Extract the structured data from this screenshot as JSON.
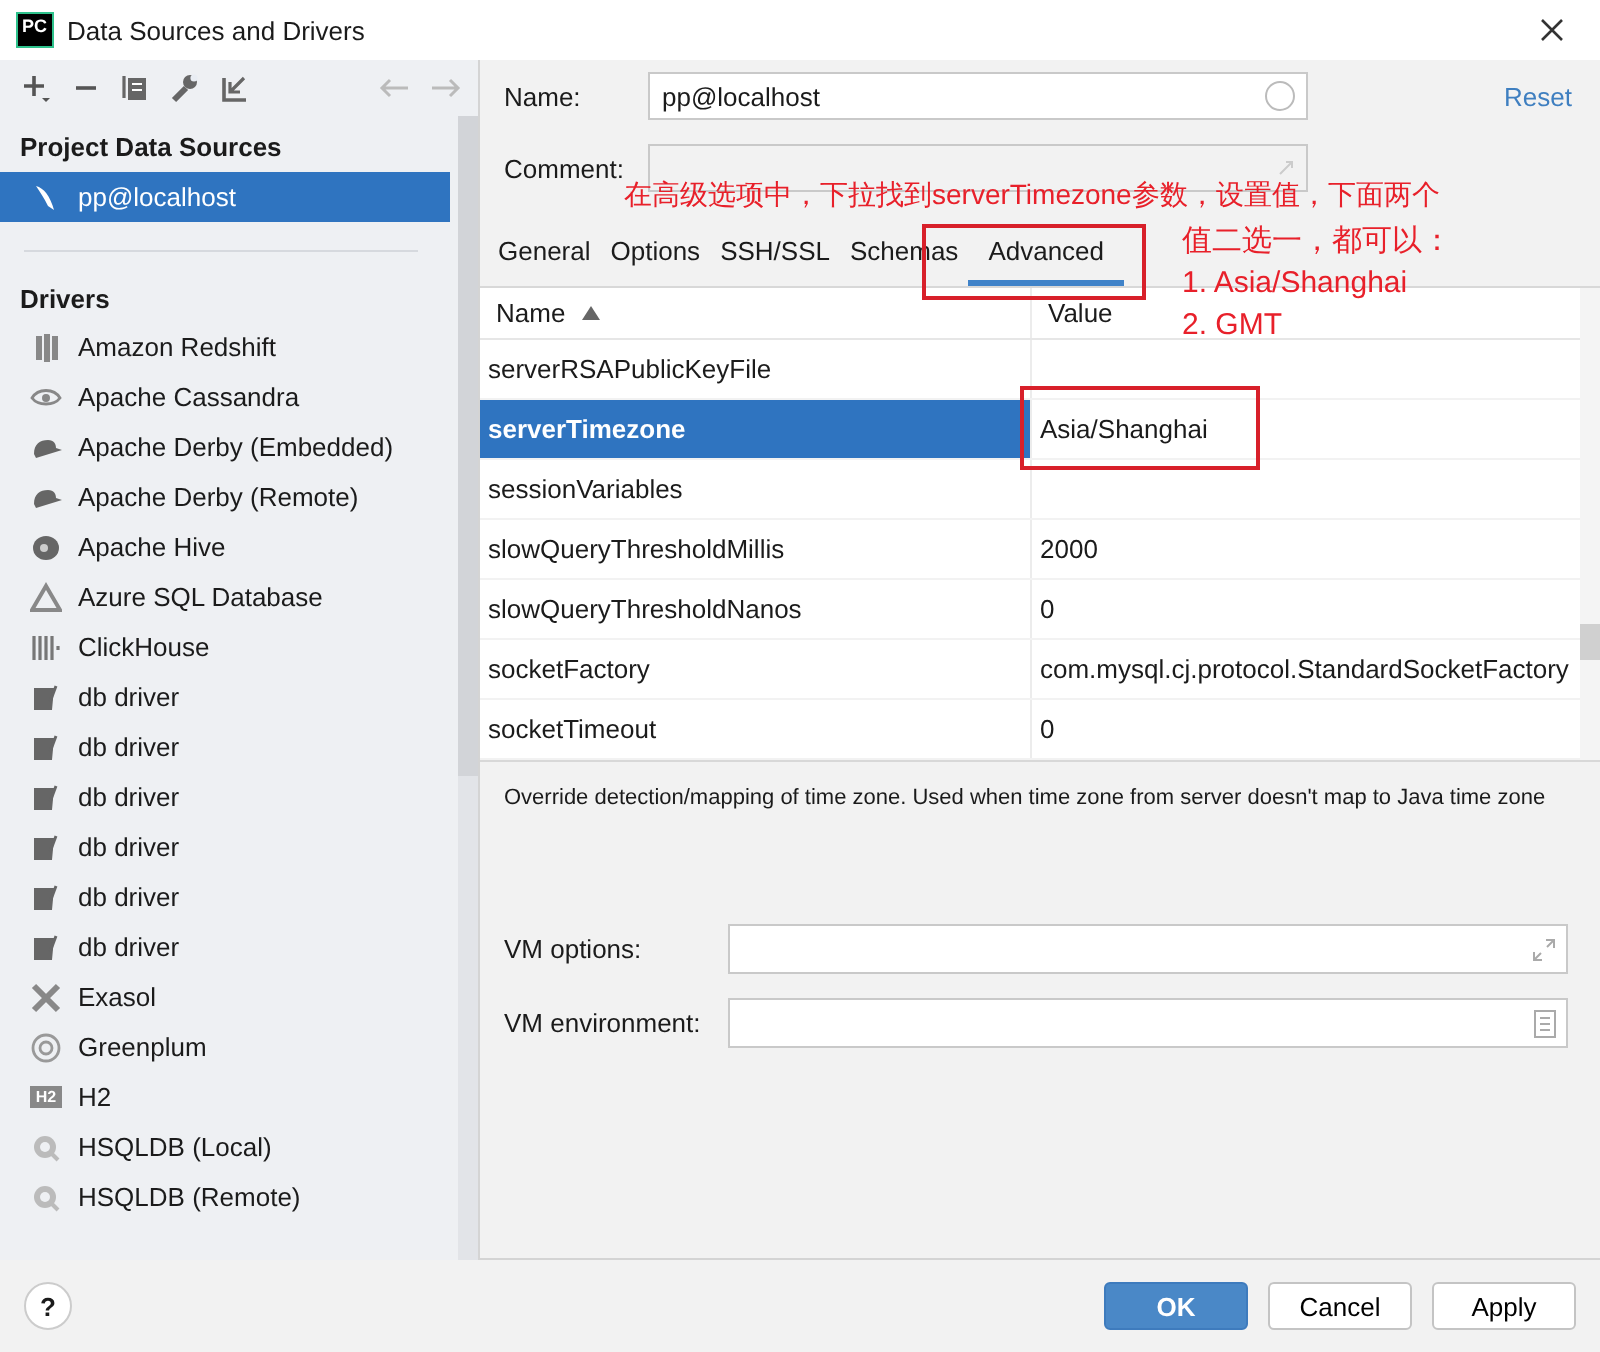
{
  "window": {
    "app_badge": "PC",
    "title": "Data Sources and Drivers"
  },
  "sidebar": {
    "project_heading": "Project Data Sources",
    "project_items": [
      {
        "label": "pp@localhost",
        "selected": true
      }
    ],
    "drivers_heading": "Drivers",
    "drivers": [
      {
        "label": "Amazon Redshift",
        "kind": "bars"
      },
      {
        "label": "Apache Cassandra",
        "kind": "eye"
      },
      {
        "label": "Apache Derby (Embedded)",
        "kind": "hat"
      },
      {
        "label": "Apache Derby (Remote)",
        "kind": "hat"
      },
      {
        "label": "Apache Hive",
        "kind": "blob"
      },
      {
        "label": "Azure SQL Database",
        "kind": "triangle"
      },
      {
        "label": "ClickHouse",
        "kind": "stripes"
      },
      {
        "label": "db driver",
        "kind": "sheet"
      },
      {
        "label": "db driver",
        "kind": "sheet"
      },
      {
        "label": "db driver",
        "kind": "sheet"
      },
      {
        "label": "db driver",
        "kind": "sheet"
      },
      {
        "label": "db driver",
        "kind": "sheet"
      },
      {
        "label": "db driver",
        "kind": "sheet"
      },
      {
        "label": "Exasol",
        "kind": "cross"
      },
      {
        "label": "Greenplum",
        "kind": "ring"
      },
      {
        "label": "H2",
        "kind": "h2",
        "badge": "H2"
      },
      {
        "label": "HSQLDB (Local)",
        "kind": "lens"
      },
      {
        "label": "HSQLDB (Remote)",
        "kind": "lens"
      }
    ]
  },
  "form": {
    "name_label": "Name:",
    "name_value": "pp@localhost",
    "reset": "Reset",
    "comment_label": "Comment:"
  },
  "tabs": [
    {
      "label": "General",
      "selected": false
    },
    {
      "label": "Options",
      "selected": false
    },
    {
      "label": "SSH/SSL",
      "selected": false
    },
    {
      "label": "Schemas",
      "selected": false
    },
    {
      "label": "Advanced",
      "selected": true
    }
  ],
  "table": {
    "columns": [
      "Name",
      "Value"
    ],
    "rows": [
      {
        "name": "serverRSAPublicKeyFile",
        "value": "",
        "selected": false
      },
      {
        "name": "serverTimezone",
        "value": "Asia/Shanghai",
        "selected": true
      },
      {
        "name": "sessionVariables",
        "value": "",
        "selected": false
      },
      {
        "name": "slowQueryThresholdMillis",
        "value": "2000",
        "selected": false
      },
      {
        "name": "slowQueryThresholdNanos",
        "value": "0",
        "selected": false
      },
      {
        "name": "socketFactory",
        "value": "com.mysql.cj.protocol.StandardSocketFactory",
        "selected": false
      },
      {
        "name": "socketTimeout",
        "value": "0",
        "selected": false
      }
    ]
  },
  "description": "Override detection/mapping of time zone. Used when time zone from server doesn't map to Java time zone",
  "vm": {
    "options_label": "VM options:",
    "environment_label": "VM environment:"
  },
  "footer": {
    "help": "?",
    "buttons": [
      {
        "label": "OK",
        "kind": "primary"
      },
      {
        "label": "Cancel",
        "kind": "plain"
      },
      {
        "label": "Apply",
        "kind": "plain"
      }
    ]
  },
  "annotations": {
    "headline": "在高级选项中，下拉找到serverTimezone参数，设置值，下面两个",
    "lines": [
      "值二选一，都可以：",
      "1.  Asia/Shanghai",
      "2. GMT"
    ]
  }
}
